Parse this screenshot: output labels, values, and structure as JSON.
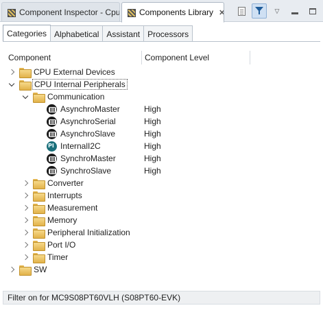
{
  "view_tabs": {
    "inspector": {
      "label": "Component Inspector - Cpu"
    },
    "library": {
      "label": "Components Library",
      "close": "✕"
    }
  },
  "category_tabs": [
    {
      "label": "Categories",
      "active": true
    },
    {
      "label": "Alphabetical",
      "active": false
    },
    {
      "label": "Assistant",
      "active": false
    },
    {
      "label": "Processors",
      "active": false
    }
  ],
  "columns": {
    "component": "Component",
    "level": "Component Level"
  },
  "tree": {
    "cpu_external": {
      "label": "CPU External Devices"
    },
    "cpu_internal": {
      "label": "CPU Internal Peripherals"
    },
    "communication": {
      "label": "Communication",
      "items": [
        {
          "name": "AsynchroMaster",
          "level": "High"
        },
        {
          "name": "AsynchroSerial",
          "level": "High"
        },
        {
          "name": "AsynchroSlave",
          "level": "High"
        },
        {
          "name": "InternalI2C",
          "level": "High"
        },
        {
          "name": "SynchroMaster",
          "level": "High"
        },
        {
          "name": "SynchroSlave",
          "level": "High"
        }
      ]
    },
    "sub_folders": [
      {
        "label": "Converter"
      },
      {
        "label": "Interrupts"
      },
      {
        "label": "Measurement"
      },
      {
        "label": "Memory"
      },
      {
        "label": "Peripheral Initialization"
      },
      {
        "label": "Port I/O"
      },
      {
        "label": "Timer"
      }
    ],
    "sw": {
      "label": "SW"
    }
  },
  "status": {
    "text": "Filter on for MC9S08PT60VLH (S08PT60-EVK)"
  },
  "colors": {
    "tab_bar": "#e8ecf1",
    "folder": "#e2b24a",
    "filter_active": "#cfe0f3"
  },
  "icons": [
    "component-icon",
    "folder-icon",
    "bean-icon",
    "filter-icon",
    "page-icon"
  ]
}
